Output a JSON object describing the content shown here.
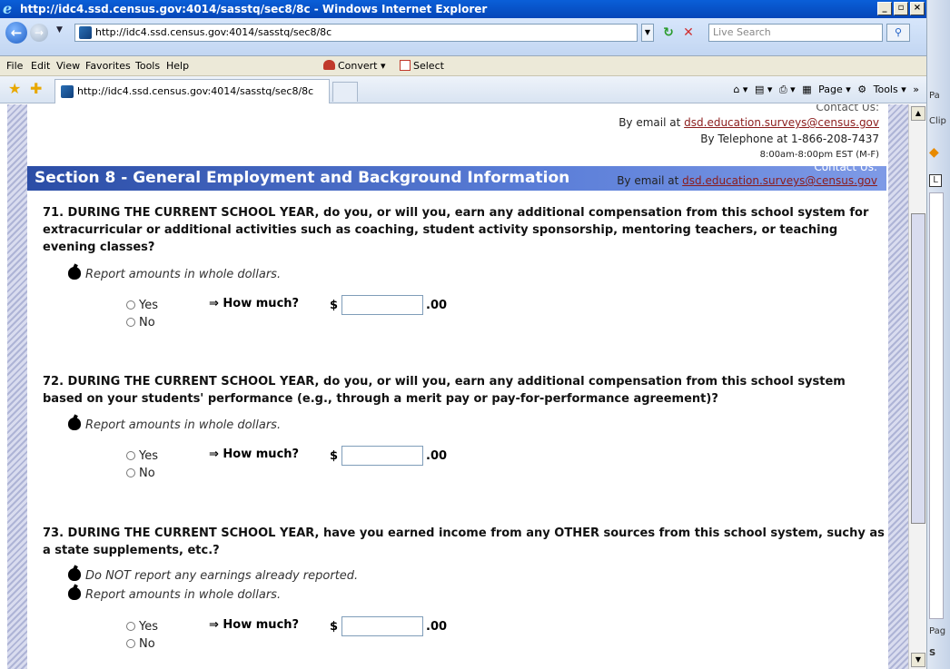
{
  "window": {
    "title": "http://idc4.ssd.census.gov:4014/sasstq/sec8/8c - Windows Internet Explorer"
  },
  "address": {
    "url": "http://idc4.ssd.census.gov:4014/sasstq/sec8/8c",
    "search_placeholder": "Live Search"
  },
  "menu": {
    "file": "File",
    "edit": "Edit",
    "view": "View",
    "favorites": "Favorites",
    "tools": "Tools",
    "help": "Help",
    "convert": "Convert",
    "select": "Select"
  },
  "tab": {
    "title": "http://idc4.ssd.census.gov:4014/sasstq/sec8/8c"
  },
  "commandbar": {
    "page": "Page",
    "tools": "Tools"
  },
  "sidepanel": {
    "pa": "Pa",
    "clip": "Clip",
    "pag": "Pag",
    "s": "S"
  },
  "contact": {
    "heading": "Contact Us:",
    "email_prefix": "By email at ",
    "email": "dsd.education.surveys@census.gov",
    "phone": "By Telephone at 1-866-208-7437",
    "hours": "8:00am-8:00pm EST (M-F)"
  },
  "section": {
    "title": "Section 8 - General Employment and Background Information"
  },
  "questions": [
    {
      "text": "71. DURING THE CURRENT SCHOOL YEAR, do you, or will you, earn any additional compensation from this school system for extracurricular or additional activities such as coaching, student activity sponsorship, mentoring teachers, or teaching evening classes?",
      "notes": [
        "Report amounts in whole dollars."
      ]
    },
    {
      "text": "72. DURING THE CURRENT SCHOOL YEAR, do you, or will you, earn any additional compensation from this school system based on your students' performance (e.g., through a merit pay or pay-for-performance agreement)?",
      "notes": [
        "Report amounts in whole dollars."
      ]
    },
    {
      "text": "73. DURING THE CURRENT SCHOOL YEAR, have you earned income from any OTHER sources from this school system, suchy as a state supplements, etc.?",
      "notes": [
        "Do NOT report any earnings already reported.",
        "Report amounts in whole dollars."
      ]
    }
  ],
  "answer": {
    "yes": "Yes",
    "no": "No",
    "how_much": "⇒ How much?",
    "currency": "$",
    "cents": ".00"
  }
}
